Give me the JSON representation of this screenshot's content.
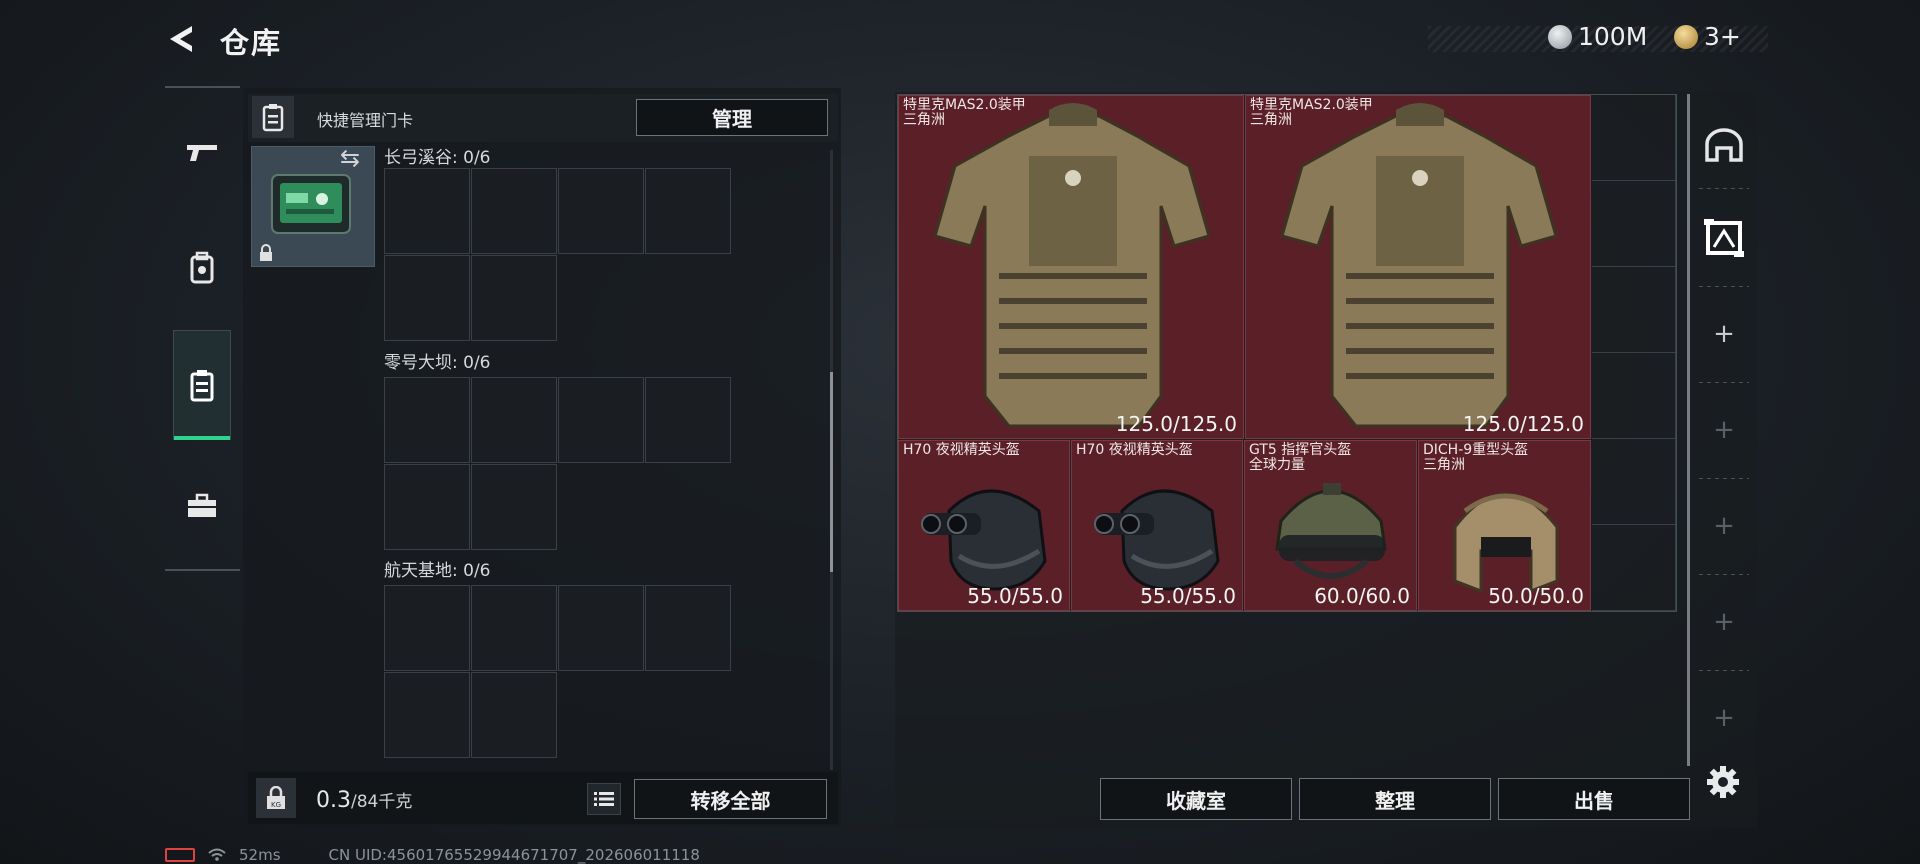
{
  "header": {
    "title": "仓库",
    "back_icon": "back-arrow-icon",
    "currencies": [
      {
        "icon": "silver-coin-icon",
        "value": "100M",
        "color": "#c8cdd2"
      },
      {
        "icon": "gold-coin-icon",
        "value": "3+",
        "color": "#c9a45c"
      }
    ]
  },
  "nav": {
    "items": [
      {
        "name": "weapon",
        "icon": "gun-icon",
        "active": false
      },
      {
        "name": "equipment",
        "icon": "backpack-icon",
        "active": false
      },
      {
        "name": "keycard",
        "icon": "keycard-icon",
        "active": true
      },
      {
        "name": "toolbox",
        "icon": "toolbox-icon",
        "active": false
      }
    ],
    "accent": "#2fd38e"
  },
  "left_panel": {
    "header_label": "快捷管理门卡",
    "manage_label": "管理",
    "zones": [
      {
        "label": "长弓溪谷: 0/6"
      },
      {
        "label": "零号大坝: 0/6"
      },
      {
        "label": "航天基地: 0/6"
      }
    ],
    "weight": {
      "current": "0.3",
      "max": "/84千克"
    },
    "transfer_all_label": "转移全部"
  },
  "right_panel": {
    "items": [
      {
        "name_line1": "特里克MAS2.0装甲",
        "name_line2": "三角洲",
        "durability": "125.0/125.0",
        "type": "armor"
      },
      {
        "name_line1": "特里克MAS2.0装甲",
        "name_line2": "三角洲",
        "durability": "125.0/125.0",
        "type": "armor"
      },
      {
        "name_line1": "H70 夜视精英头盔",
        "name_line2": "",
        "durability": "55.0/55.0",
        "type": "nvg-helmet"
      },
      {
        "name_line1": "H70 夜视精英头盔",
        "name_line2": "",
        "durability": "55.0/55.0",
        "type": "nvg-helmet"
      },
      {
        "name_line1": "GT5 指挥官头盔",
        "name_line2": "全球力量",
        "durability": "60.0/60.0",
        "type": "commander-helmet"
      },
      {
        "name_line1": "DICH-9重型头盔",
        "name_line2": "三角洲",
        "durability": "50.0/50.0",
        "type": "heavy-helmet"
      }
    ],
    "item_bg_color": "#5b2027",
    "buttons": {
      "collection": "收藏室",
      "organize": "整理",
      "sell": "出售"
    },
    "side_plus": "+"
  },
  "status": {
    "ping": "52ms",
    "uid": "CN UID:4560176552994467170​7_202606011118"
  }
}
